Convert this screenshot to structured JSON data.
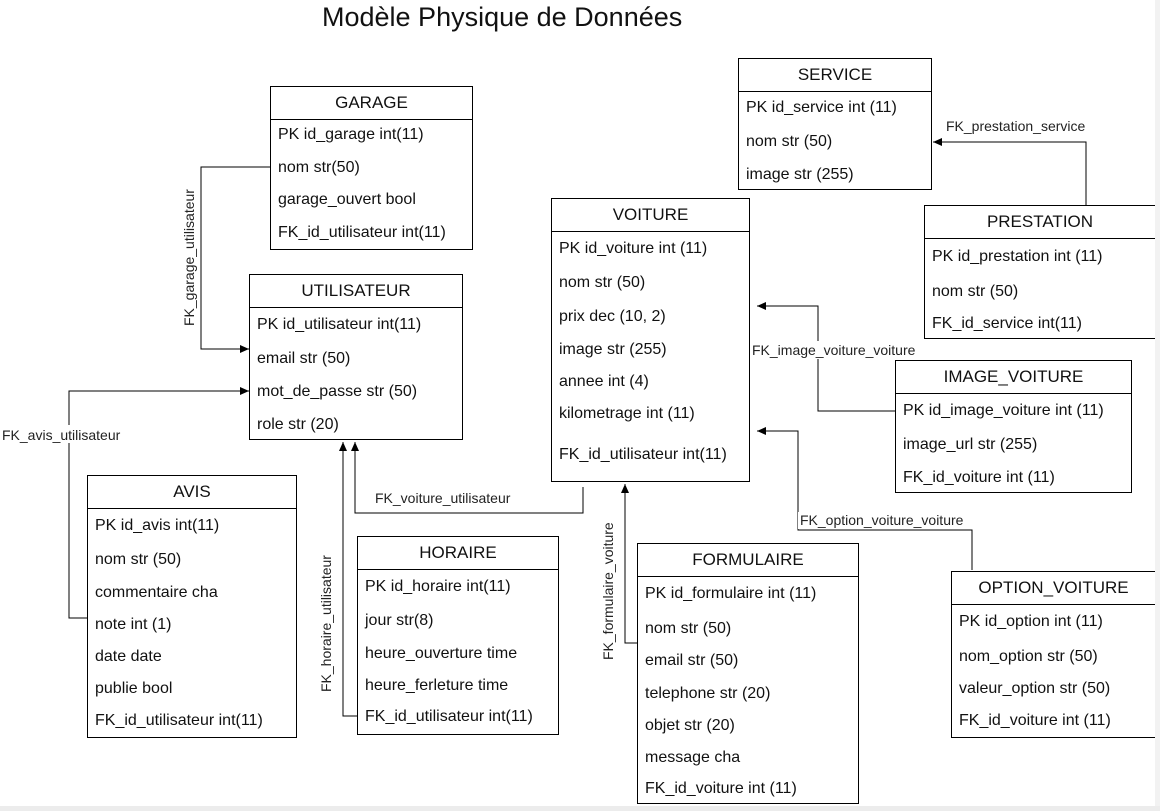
{
  "title": "Modèle Physique de Données",
  "entities": [
    {
      "id": "garage",
      "name": "GARAGE",
      "fields": [
        "PK id_garage int(11)",
        "nom str(50)",
        "garage_ouvert bool",
        "FK_id_utilisateur int(11)"
      ]
    },
    {
      "id": "utilisateur",
      "name": "UTILISATEUR",
      "fields": [
        "PK id_utilisateur int(11)",
        "email str (50)",
        "mot_de_passe str (50)",
        "role str (20)"
      ]
    },
    {
      "id": "avis",
      "name": "AVIS",
      "fields": [
        "PK id_avis int(11)",
        "nom str (50)",
        "commentaire cha",
        "note int (1)",
        "date date",
        "publie bool",
        "FK_id_utilisateur int(11)"
      ]
    },
    {
      "id": "horaire",
      "name": "HORAIRE",
      "fields": [
        "PK id_horaire int(11)",
        "jour str(8)",
        "heure_ouverture time",
        "heure_ferleture time",
        "FK_id_utilisateur int(11)"
      ]
    },
    {
      "id": "voiture",
      "name": "VOITURE",
      "fields": [
        "PK id_voiture int (11)",
        "nom str (50)",
        "prix dec (10, 2)",
        "image str (255)",
        "annee int (4)",
        "kilometrage int (11)",
        "FK_id_utilisateur int(11)"
      ]
    },
    {
      "id": "formulaire",
      "name": "FORMULAIRE",
      "fields": [
        "PK id_formulaire int (11)",
        "nom str (50)",
        "email str (50)",
        "telephone str (20)",
        "objet str (20)",
        "message cha",
        "FK_id_voiture int (11)"
      ]
    },
    {
      "id": "service",
      "name": "SERVICE",
      "fields": [
        "PK id_service int (11)",
        "nom str (50)",
        "image str (255)"
      ]
    },
    {
      "id": "prestation",
      "name": "PRESTATION",
      "fields": [
        "PK id_prestation int (11)",
        "nom str (50)",
        "FK_id_service int(11)"
      ]
    },
    {
      "id": "image_voiture",
      "name": "IMAGE_VOITURE",
      "fields": [
        "PK id_image_voiture int (11)",
        "image_url str (255)",
        "FK_id_voiture int (11)"
      ]
    },
    {
      "id": "option_voiture",
      "name": "OPTION_VOITURE",
      "fields": [
        "PK id_option int (11)",
        "nom_option str (50)",
        "valeur_option str (50)",
        "FK_id_voiture int (11)"
      ]
    }
  ],
  "relations": [
    {
      "id": "garage_utilisateur",
      "label": "FK_garage_utilisateur",
      "from": "garage",
      "to": "utilisateur"
    },
    {
      "id": "avis_utilisateur",
      "label": "FK_avis_utilisateur",
      "from": "avis",
      "to": "utilisateur"
    },
    {
      "id": "horaire_utilisateur",
      "label": "FK_horaire_utilisateur",
      "from": "horaire",
      "to": "utilisateur"
    },
    {
      "id": "voiture_utilisateur",
      "label": "FK_voiture_utilisateur",
      "from": "voiture",
      "to": "utilisateur"
    },
    {
      "id": "formulaire_voiture",
      "label": "FK_formulaire_voiture",
      "from": "formulaire",
      "to": "voiture"
    },
    {
      "id": "image_voiture_voiture",
      "label": "FK_image_voiture_voiture",
      "from": "image_voiture",
      "to": "voiture"
    },
    {
      "id": "option_voiture_voiture",
      "label": "FK_option_voiture_voiture",
      "from": "option_voiture",
      "to": "voiture"
    },
    {
      "id": "prestation_service",
      "label": "FK_prestation_service",
      "from": "prestation",
      "to": "service"
    }
  ]
}
